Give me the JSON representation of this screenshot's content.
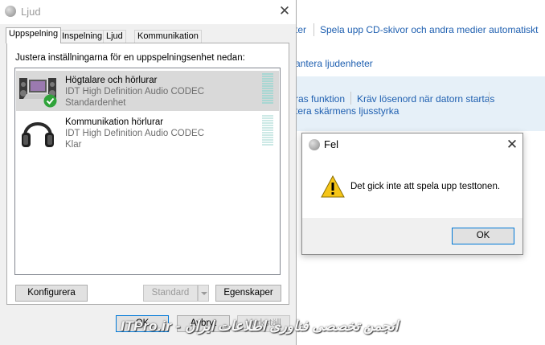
{
  "background_panel": {
    "links": [
      "ter",
      "Spela upp CD-skivor och andra medier automatiskt",
      "antera ljudenheter",
      "ras funktion",
      "Kräv lösenord när datorn startas",
      "tera skärmens ljusstyrka"
    ]
  },
  "sound_dialog": {
    "title": "Ljud",
    "close_glyph": "✕",
    "tabs": [
      "Uppspelning",
      "Inspelning",
      "Ljud",
      "Kommunikation"
    ],
    "active_tab": "Uppspelning",
    "instruction": "Justera inställningarna för en uppspelningsenhet nedan:",
    "devices": [
      {
        "name": "Högtalare och hörlurar",
        "driver": "IDT High Definition Audio CODEC",
        "status": "Standardenhet",
        "icon": "speakers-laptop-icon",
        "default_badge": "green-check-icon",
        "selected": true
      },
      {
        "name": "Kommunikation hörlurar",
        "driver": "IDT High Definition Audio CODEC",
        "status": "Klar",
        "icon": "headphones-icon",
        "selected": false
      }
    ],
    "buttons": {
      "configure": "Konfigurera",
      "set_default": "Standard",
      "properties": "Egenskaper",
      "ok": "OK",
      "cancel": "Avbryt",
      "apply": "Verkställ"
    }
  },
  "error_dialog": {
    "title": "Fel",
    "close_glyph": "✕",
    "message": "Det gick inte att spela upp testtonen.",
    "icon": "warning-icon",
    "ok_label": "OK"
  },
  "watermark": {
    "text": "ITPro.ir - انجمن تخصصی فناوری اطلاعات ایران"
  },
  "colors": {
    "link": "#1e5fb0",
    "selection": "#d9d9d9",
    "level_meter": "#a9d7d3",
    "focus_border": "#0078d7",
    "warning": "#f5c518"
  }
}
